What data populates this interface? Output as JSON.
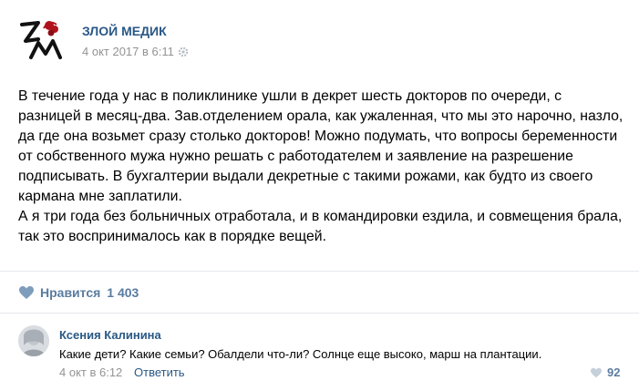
{
  "post": {
    "author": "ЗЛОЙ МЕДИК",
    "date": "4 окт 2017 в 6:11",
    "paragraphs": [
      "В течение года у нас в поликлинике ушли в декрет шесть докторов по очереди, с разницей в месяц-два. Зав.отделением орала, как ужаленная, что мы это нарочно, назло, да где она возьмет сразу столько докторов! Можно подумать, что вопросы беременности от собственного мужа нужно решать с работодателем и заявление на разрешение подписывать. В бухгалтерии выдали декретные с такими рожами, как будто из своего кармана мне заплатили.",
      "А я три года без больничных отработала, и в командировки ездила, и совмещения брала, так это воспринималось как в порядке вещей."
    ],
    "like_label": "Нравится",
    "like_count": "1 403"
  },
  "comment": {
    "author": "Ксения Калинина",
    "text": "Какие дети? Какие семьи? Обалдели что-ли? Солнце еще высоко, марш на плантации.",
    "date": "4 окт в 6:12",
    "reply_label": "Ответить",
    "like_count": "92"
  },
  "colors": {
    "link_blue": "#2a5885",
    "like_blue": "#5a7ca0",
    "gray": "#939393",
    "divider": "#e7e8ec"
  },
  "icons": [
    "logo-icon",
    "gear-icon",
    "heart-icon",
    "avatar-icon"
  ]
}
